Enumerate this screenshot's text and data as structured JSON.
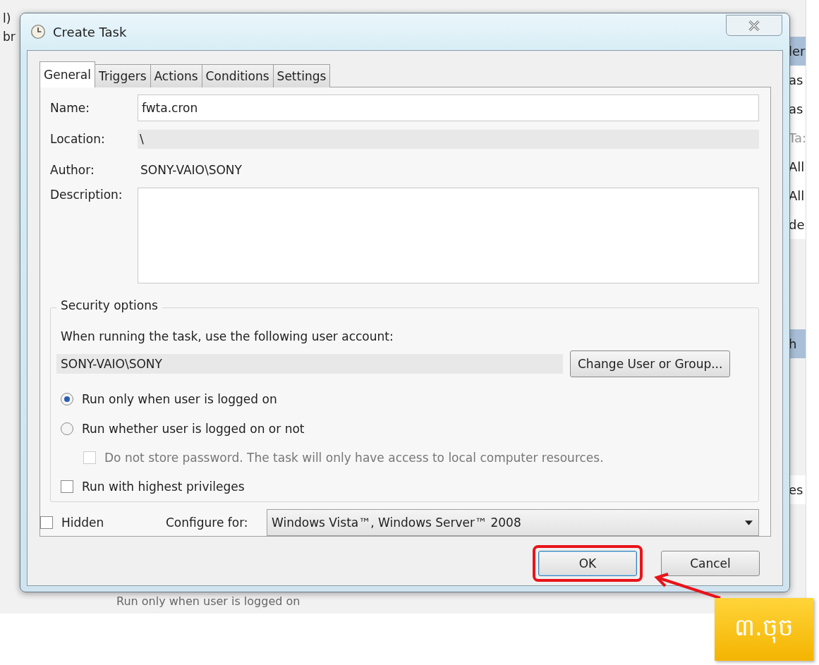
{
  "background": {
    "left_fragments": [
      "l)",
      "br"
    ],
    "right_groups": [
      [
        {
          "text": "ler",
          "selected": true,
          "disabled": false
        },
        {
          "text": "as",
          "selected": false,
          "disabled": false
        },
        {
          "text": "as",
          "selected": false,
          "disabled": false
        },
        {
          "text": "Ta:",
          "selected": false,
          "disabled": true
        },
        {
          "text": "All",
          "selected": false,
          "disabled": false
        },
        {
          "text": "All",
          "selected": false,
          "disabled": false
        },
        {
          "text": "de",
          "selected": false,
          "disabled": false
        }
      ],
      [
        {
          "text": "h",
          "selected": true,
          "disabled": false
        }
      ],
      [
        {
          "text": "es",
          "selected": false,
          "disabled": false
        }
      ]
    ],
    "bottom_text": "Run only when user is logged on"
  },
  "dialog": {
    "title": "Create Task",
    "tabs": [
      {
        "label": "General",
        "selected": true
      },
      {
        "label": "Triggers",
        "selected": false
      },
      {
        "label": "Actions",
        "selected": false
      },
      {
        "label": "Conditions",
        "selected": false
      },
      {
        "label": "Settings",
        "selected": false
      }
    ],
    "name": {
      "label": "Name:",
      "value": "fwta.cron"
    },
    "location": {
      "label": "Location:",
      "value": "\\"
    },
    "author": {
      "label": "Author:",
      "value": "SONY-VAIO\\SONY"
    },
    "description": {
      "label": "Description:"
    },
    "security": {
      "title": "Security options",
      "account_label": "When running the task, use the following user account:",
      "account": "SONY-VAIO\\SONY",
      "change_button": "Change User or Group...",
      "options": [
        {
          "kind": "radio",
          "label": "Run only when user is logged on",
          "selected": true,
          "disabled": false,
          "indent": false
        },
        {
          "kind": "radio",
          "label": "Run whether user is logged on or not",
          "selected": false,
          "disabled": false,
          "indent": false
        },
        {
          "kind": "checkbox",
          "label": "Do not store password.  The task will only have access to local computer resources.",
          "selected": false,
          "disabled": true,
          "indent": true
        },
        {
          "kind": "checkbox",
          "label": "Run with highest privileges",
          "selected": false,
          "disabled": false,
          "indent": false
        }
      ]
    },
    "hidden": {
      "label": "Hidden",
      "checked": false
    },
    "configure": {
      "label": "Configure for:",
      "value": "Windows Vista™, Windows Server™ 2008"
    },
    "buttons": [
      {
        "label": "OK",
        "highlighted": true
      },
      {
        "label": "Cancel",
        "highlighted": false
      }
    ]
  },
  "callout": {
    "text": "៣.ចុច"
  }
}
